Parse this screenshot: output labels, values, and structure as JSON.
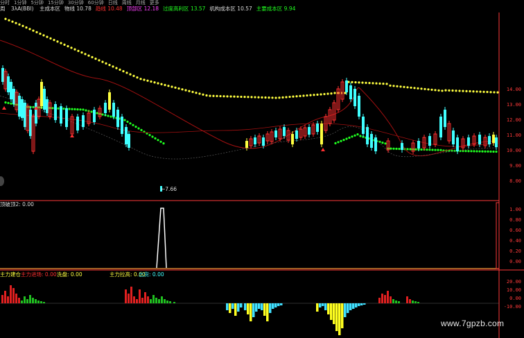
{
  "topbar": {
    "items": [
      "分时",
      "1分钟",
      "5分钟",
      "15分钟",
      "30分钟",
      "60分钟",
      "日线",
      "周线",
      "月线",
      "更多"
    ]
  },
  "indicator_row": {
    "prefix": "周",
    "name": "3λA(BBI)",
    "items": [
      {
        "label": "主成本区",
        "value": "",
        "color": "#dddddd"
      },
      {
        "label": "物线",
        "value": "10.78",
        "color": "#dddddd"
      },
      {
        "label": "趋线",
        "value": "10.48",
        "color": "#ff3030"
      },
      {
        "label": "顶部区",
        "value": "12.18",
        "color": "#ff40ff"
      },
      {
        "label": "过度高利区",
        "value": "13.57",
        "color": "#20ff20"
      },
      {
        "label": "机构成本区",
        "value": "10.57",
        "color": "#dddddd"
      },
      {
        "label": "主要成本区",
        "value": "9.94",
        "color": "#20ff20"
      }
    ]
  },
  "main_panel": {
    "price_marker": "←7.66",
    "y_ticks": [
      "14.00",
      "13.00",
      "12.00",
      "11.00",
      "10.00",
      "9.00",
      "8.00"
    ]
  },
  "osc_panel": {
    "title": "顶破顶2: 0.00",
    "y_ticks": [
      "1.00",
      "0.80",
      "0.60",
      "0.40",
      "0.20",
      "0.00"
    ]
  },
  "flow_panel": {
    "labels": [
      {
        "text": "主力建仓",
        "color": "#ffff40"
      },
      {
        "text": "主力进场: 0.00",
        "color": "#ff3030"
      },
      {
        "text": "洗盘: 0.00",
        "color": "#ffff40"
      },
      {
        "text": "主力拉高: 0.00",
        "color": "#ffff40"
      },
      {
        "text": "出货: 0.00",
        "color": "#40ffff"
      }
    ],
    "y_ticks": [
      "20.00",
      "10.00",
      "0.00",
      "-10.00"
    ]
  },
  "watermark": "www.7gpzb.com",
  "colors": {
    "background": "#000000",
    "up_candle": "#ff3030",
    "down_candle": "#40ffff",
    "yellow_band": "#ffff40",
    "green_band": "#20ff20",
    "axis": "#ff3a3a"
  }
}
